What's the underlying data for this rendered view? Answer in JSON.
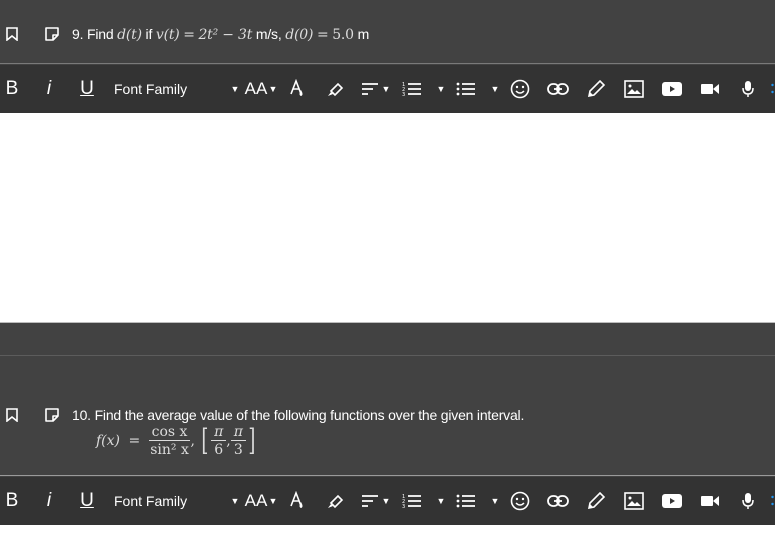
{
  "questions": [
    {
      "number": "9.",
      "text_prefix": "Find",
      "d_t": "d(t)",
      "if_word": "if",
      "v_t": "v(t)",
      "equals": "=",
      "expr": "2t² − 3t",
      "units_velocity": "m/s,",
      "d0": "d(0)",
      "d0_value": "5.0",
      "units_distance": "m"
    },
    {
      "number": "10.",
      "text": "Find the average value of the following functions over the given interval.",
      "function_lhs": "f(x)",
      "equals": "=",
      "numerator": "cos x",
      "denominator": "sin² x",
      "comma": ",",
      "interval_left_num": "π",
      "interval_left_den": "6",
      "interval_right_num": "π",
      "interval_right_den": "3"
    }
  ],
  "toolbar": {
    "bold": "B",
    "italic": "i",
    "underline": "U",
    "font_family": "Font Family",
    "font_size": "AA"
  },
  "icons": {
    "bookmark": "bookmark-icon",
    "note": "note-icon",
    "font_color": "font-color-icon",
    "highlight": "highlighter-icon",
    "align": "align-icon",
    "ordered_list": "ordered-list-icon",
    "bullet_list": "bullet-list-icon",
    "emoji": "emoji-icon",
    "link": "link-icon",
    "draw": "pencil-icon",
    "image": "image-icon",
    "youtube": "youtube-icon",
    "video": "video-camera-icon",
    "mic": "microphone-icon"
  },
  "colors": {
    "header_bg": "#424242",
    "toolbar_bg": "#333333",
    "editor_bg": "#ffffff",
    "text": "#ffffff",
    "accent_dots": "#2196f3"
  }
}
